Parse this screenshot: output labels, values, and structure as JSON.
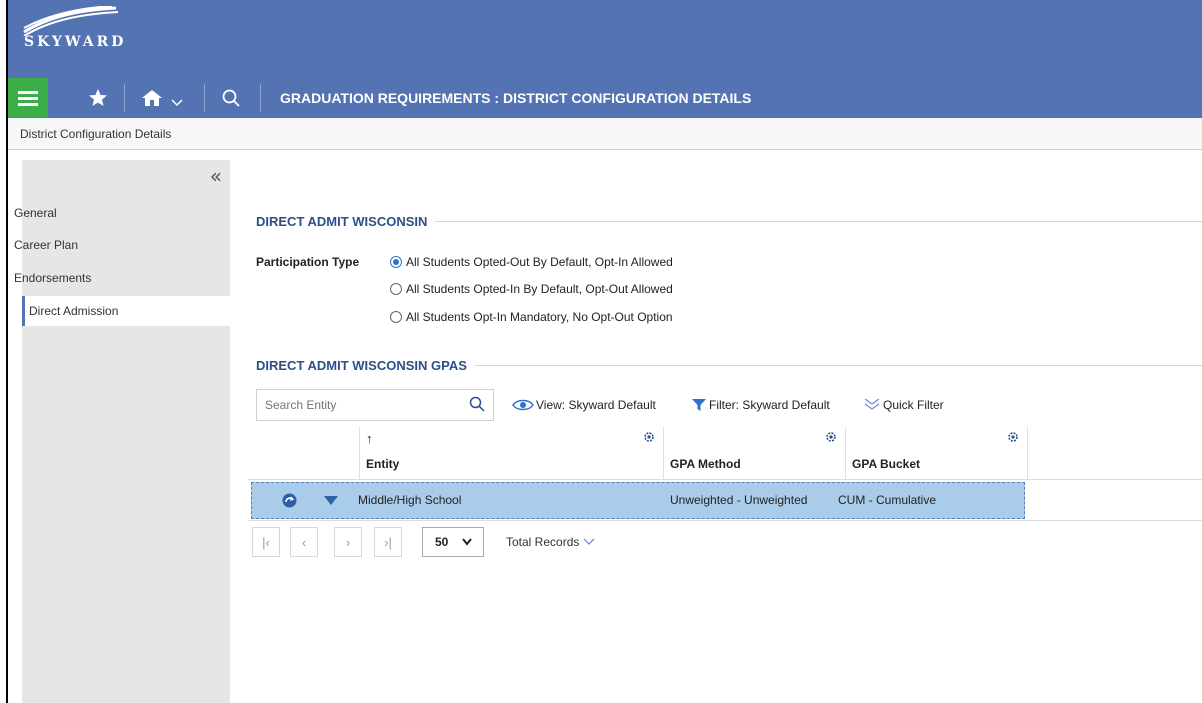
{
  "header": {
    "logo_text": "SKYWARD"
  },
  "nav": {
    "title": "GRADUATION REQUIREMENTS : DISTRICT CONFIGURATION DETAILS"
  },
  "breadcrumb": "District Configuration Details",
  "sidebar": {
    "items": [
      {
        "label": "General"
      },
      {
        "label": "Career Plan"
      },
      {
        "label": "Endorsements"
      },
      {
        "label": "Direct Admission"
      }
    ]
  },
  "section1": {
    "title": "DIRECT ADMIT WISCONSIN",
    "participation_label": "Participation Type",
    "options": [
      "All Students Opted-Out By Default, Opt-In Allowed",
      "All Students Opted-In By Default, Opt-Out Allowed",
      "All Students Opt-In Mandatory, No Opt-Out Option"
    ],
    "selected_index": 0
  },
  "section2": {
    "title": "DIRECT ADMIT WISCONSIN GPAS",
    "search_placeholder": "Search Entity",
    "view_label": "View: Skyward Default",
    "filter_label": "Filter: Skyward Default",
    "quick_filter_label": "Quick Filter",
    "columns": [
      "Entity",
      "GPA Method",
      "GPA Bucket"
    ],
    "rows": [
      {
        "entity": "Middle/High School",
        "gpa_method": "Unweighted - Unweighted",
        "gpa_bucket": "CUM - Cumulative"
      }
    ],
    "page_size": "50",
    "total_records_label": "Total Records"
  },
  "colors": {
    "header_blue": "#5373b3",
    "nav_green": "#3cae49",
    "row_selected": "#a9ccea",
    "section_title": "#2c4f8a"
  }
}
